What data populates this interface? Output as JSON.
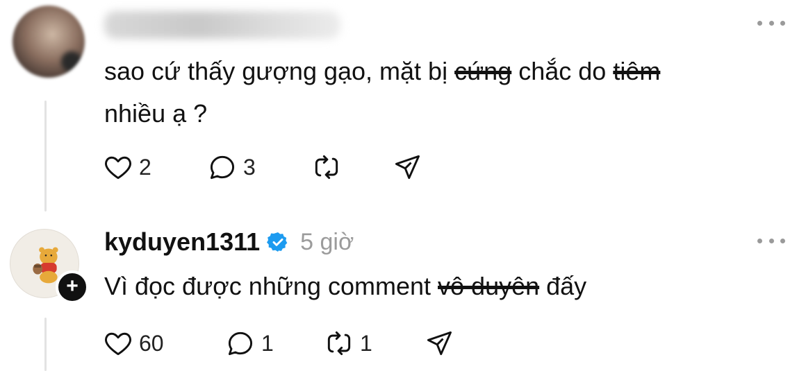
{
  "comment1": {
    "text_part1": "sao cứ thấy gượng gạo, mặt bị ",
    "struck1": "cứng",
    "text_part2": " chắc do ",
    "struck2": "tiêm",
    "line2": "nhiều ạ ?",
    "likes": "2",
    "replies": "3"
  },
  "comment2": {
    "username": "kyduyen1311",
    "time": "5 giờ",
    "text_part1": "Vì đọc được những comment ",
    "struck": "vô duyên",
    "text_part2": " đấy",
    "likes": "60",
    "replies": "1",
    "reposts": "1"
  },
  "colors": {
    "verified": "#1d9bf0",
    "thread_line": "#e3e3e3",
    "muted": "#9b9b9b"
  }
}
